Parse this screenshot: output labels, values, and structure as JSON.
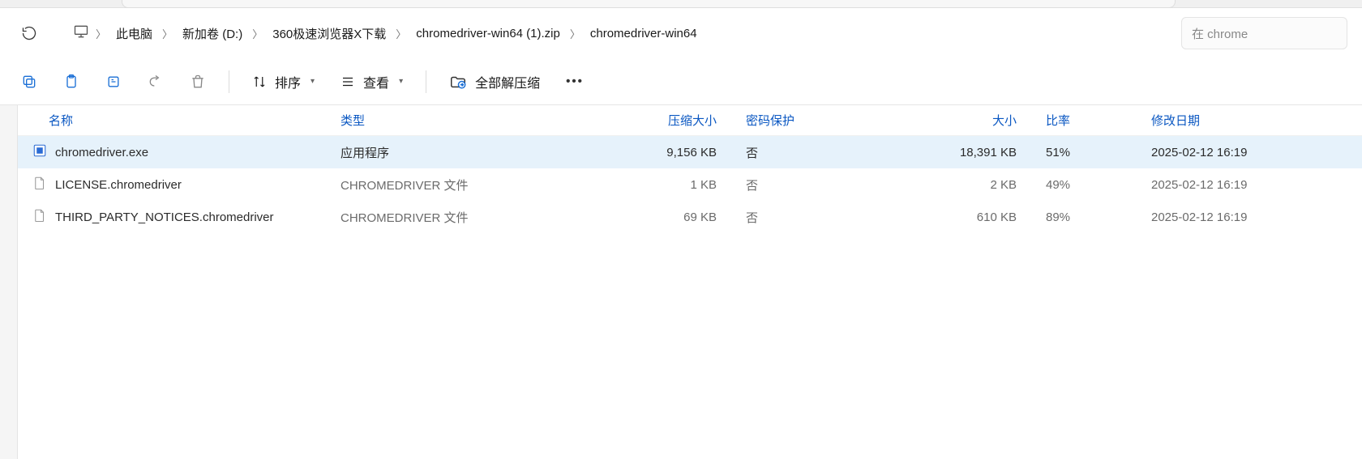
{
  "breadcrumb": {
    "items": [
      "此电脑",
      "新加卷 (D:)",
      "360极速浏览器X下载",
      "chromedriver-win64 (1).zip",
      "chromedriver-win64"
    ]
  },
  "search": {
    "placeholder": "在 chrome"
  },
  "toolbar": {
    "sort_label": "排序",
    "view_label": "查看",
    "extract_all_label": "全部解压缩"
  },
  "columns": {
    "name": "名称",
    "type": "类型",
    "compressed_size": "压缩大小",
    "password_protected": "密码保护",
    "size": "大小",
    "ratio": "比率",
    "modified": "修改日期"
  },
  "rows": [
    {
      "name": "chromedriver.exe",
      "type": "应用程序",
      "compressed_size": "9,156 KB",
      "password_protected": "否",
      "size": "18,391 KB",
      "ratio": "51%",
      "modified": "2025-02-12 16:19",
      "icon": "exe",
      "selected": true
    },
    {
      "name": "LICENSE.chromedriver",
      "type": "CHROMEDRIVER 文件",
      "compressed_size": "1 KB",
      "password_protected": "否",
      "size": "2 KB",
      "ratio": "49%",
      "modified": "2025-02-12 16:19",
      "icon": "file",
      "selected": false
    },
    {
      "name": "THIRD_PARTY_NOTICES.chromedriver",
      "type": "CHROMEDRIVER 文件",
      "compressed_size": "69 KB",
      "password_protected": "否",
      "size": "610 KB",
      "ratio": "89%",
      "modified": "2025-02-12 16:19",
      "icon": "file",
      "selected": false
    }
  ]
}
